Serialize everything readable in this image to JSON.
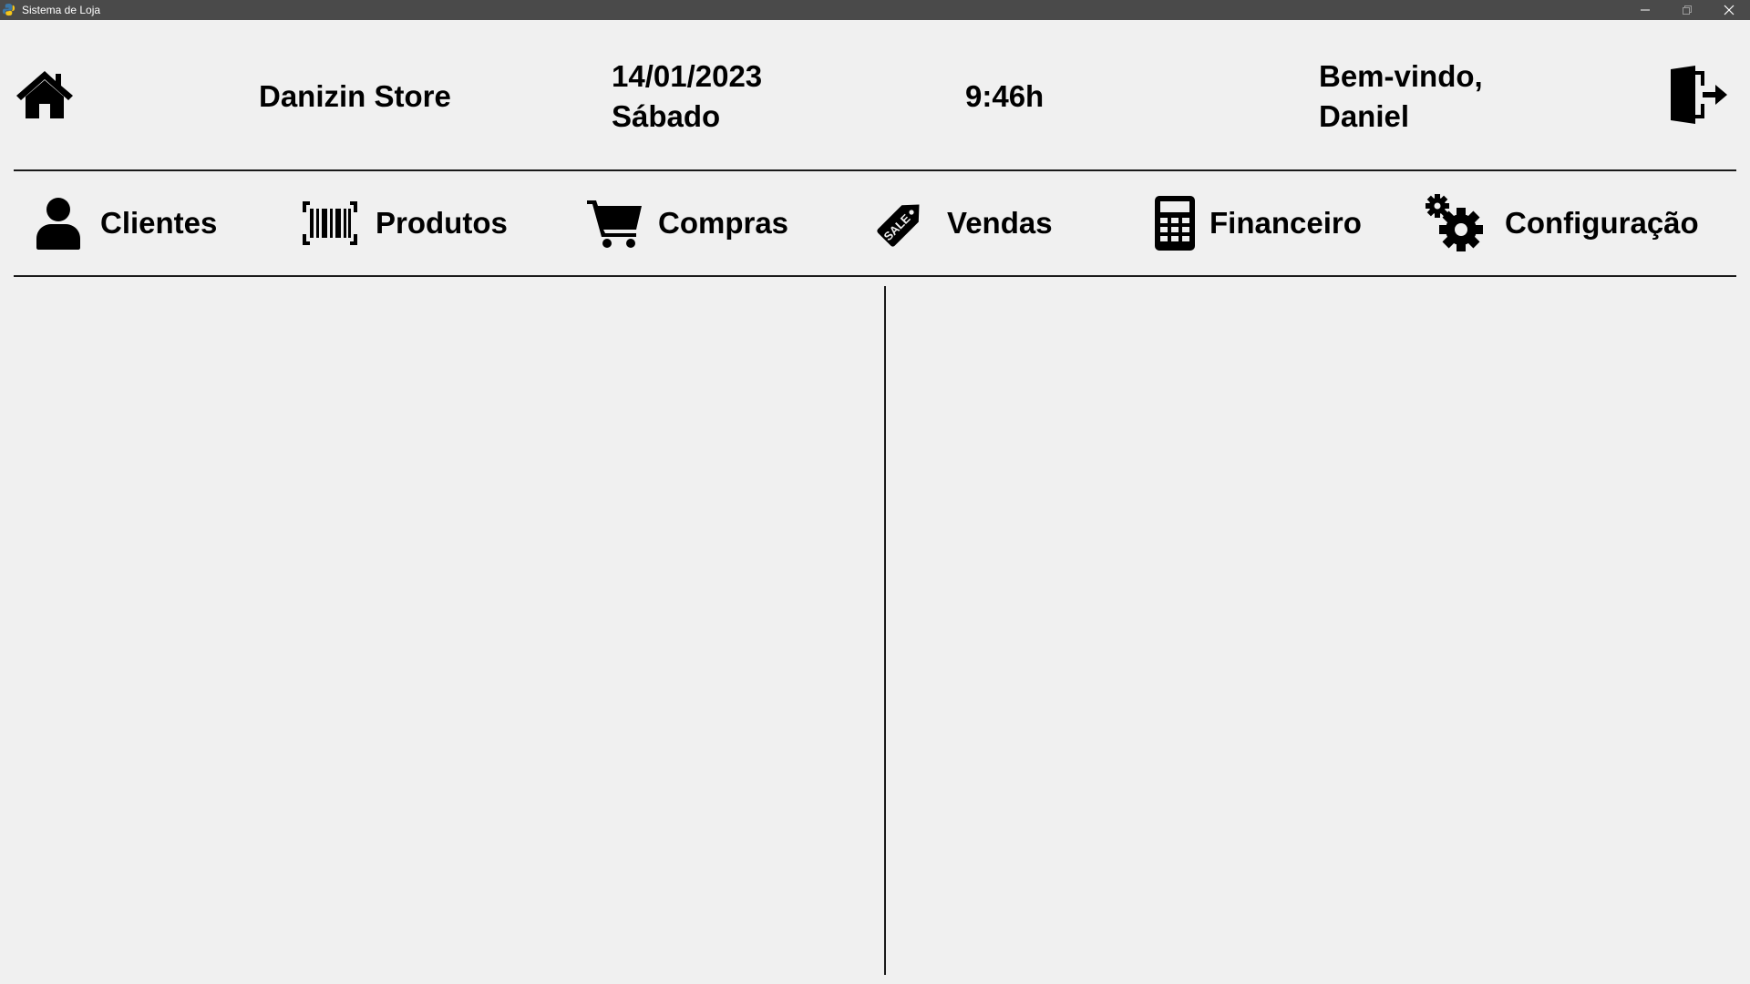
{
  "window": {
    "title": "Sistema de Loja",
    "icon": "python-icon",
    "controls": [
      "minimize-icon",
      "maximize-icon",
      "close-icon"
    ]
  },
  "header": {
    "home_icon": "home-icon",
    "store_name": "Danizin Store",
    "date": "14/01/2023",
    "weekday": "Sábado",
    "time": "9:46h",
    "welcome_line1": "Bem-vindo,",
    "welcome_line2": "Daniel",
    "logout_icon": "logout-door-icon"
  },
  "nav": {
    "items": [
      {
        "label": "Clientes",
        "icon": "user-icon"
      },
      {
        "label": "Produtos",
        "icon": "barcode-icon"
      },
      {
        "label": "Compras",
        "icon": "shopping-cart-icon"
      },
      {
        "label": "Vendas",
        "icon": "sale-tag-icon",
        "icon_text": "SALE"
      },
      {
        "label": "Financeiro",
        "icon": "calculator-icon"
      },
      {
        "label": "Configuração",
        "icon": "gears-icon"
      }
    ]
  }
}
